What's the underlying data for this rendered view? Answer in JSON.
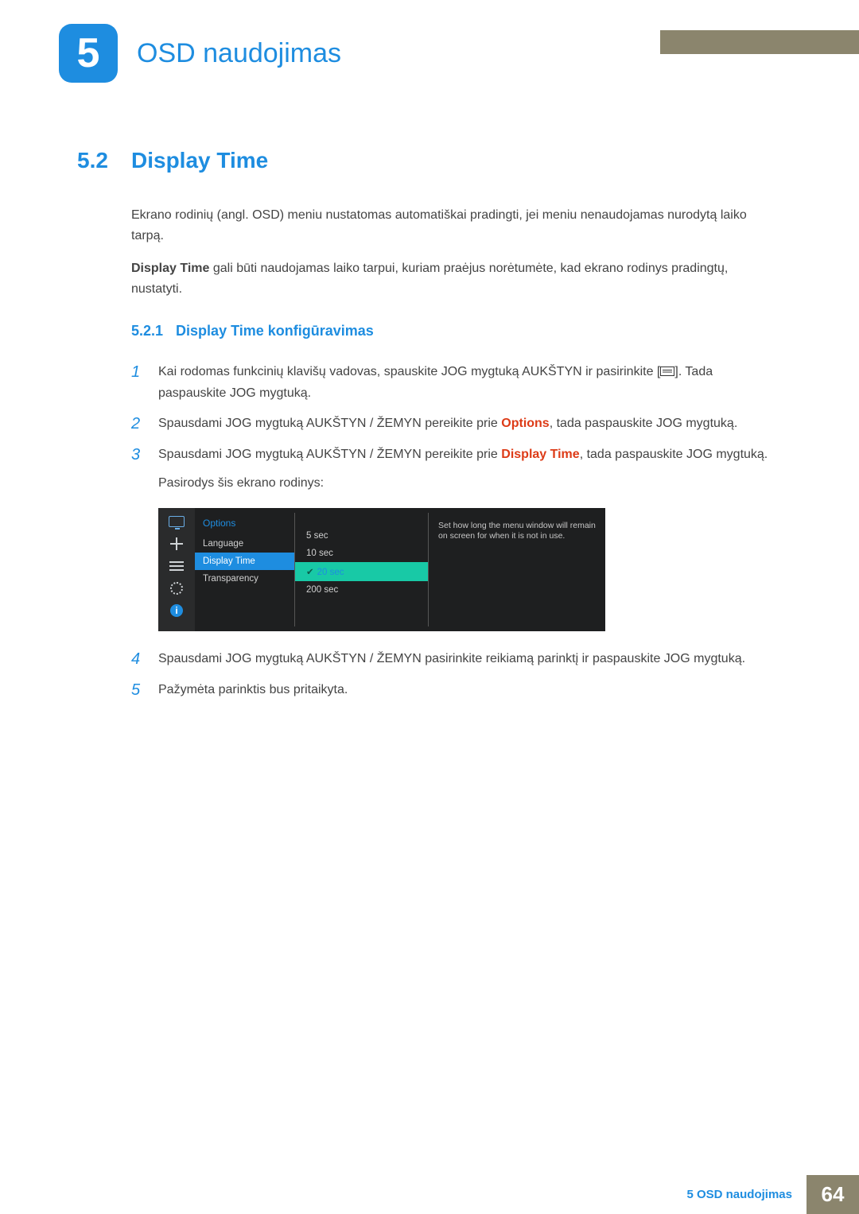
{
  "chapter": {
    "number": "5",
    "title": "OSD naudojimas"
  },
  "section": {
    "number": "5.2",
    "title": "Display Time",
    "para1": "Ekrano rodinių (angl. OSD) meniu nustatomas automatiškai pradingti, jei meniu nenaudojamas nurodytą laiko tarpą.",
    "para2_label": "Display Time",
    "para2_rest": " gali būti naudojamas laiko tarpui, kuriam praėjus norėtumėte, kad ekrano rodinys pradingtų, nustatyti."
  },
  "subsection": {
    "number": "5.2.1",
    "title": "Display Time konfigūravimas"
  },
  "steps": {
    "s1_a": "Kai rodomas funkcinių klavišų vadovas, spauskite JOG mygtuką AUKŠTYN ir pasirinkite [",
    "s1_b": "]. Tada paspauskite JOG mygtuką.",
    "s2_a": "Spausdami JOG mygtuką AUKŠTYN / ŽEMYN pereikite prie ",
    "s2_red": "Options",
    "s2_b": ", tada paspauskite JOG mygtuką.",
    "s3_a": "Spausdami JOG mygtuką AUKŠTYN / ŽEMYN pereikite prie ",
    "s3_red": "Display Time",
    "s3_b": ", tada paspauskite JOG mygtuką.",
    "s3_c": "Pasirodys šis ekrano rodinys:",
    "s4": "Spausdami JOG mygtuką AUKŠTYN / ŽEMYN pasirinkite reikiamą parinktį ir paspauskite JOG mygtuką.",
    "s5": "Pažymėta parinktis bus pritaikyta."
  },
  "osd": {
    "header": "Options",
    "menu": [
      "Language",
      "Display Time",
      "Transparency"
    ],
    "menu_selected_index": 1,
    "values": [
      "5 sec",
      "10 sec",
      "20 sec",
      "200 sec"
    ],
    "values_selected_index": 2,
    "help": "Set how long the menu window will remain on screen for when it is not in use."
  },
  "footer": {
    "label": "5 OSD naudojimas",
    "page": "64"
  }
}
